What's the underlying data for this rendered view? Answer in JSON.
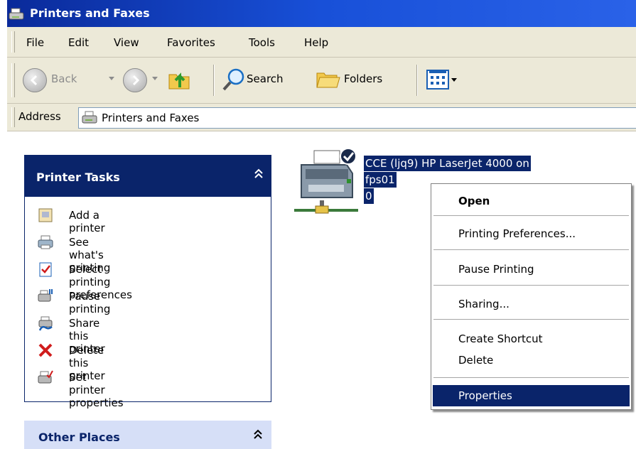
{
  "window": {
    "title": "Printers and Faxes"
  },
  "menu": [
    "File",
    "Edit",
    "View",
    "Favorites",
    "Tools",
    "Help"
  ],
  "toolbar": {
    "back_label": "Back",
    "search_label": "Search",
    "folders_label": "Folders"
  },
  "address": {
    "label": "Address",
    "value": "Printers and Faxes"
  },
  "tasks": {
    "title": "Printer Tasks",
    "items": [
      "Add a printer",
      "See what's printing",
      "Select printing preferences",
      "Pause printing",
      "Share this printer",
      "Delete this printer",
      "Set printer properties"
    ]
  },
  "other_places": {
    "title": "Other Places"
  },
  "printer": {
    "line1": "CCE (ljq9) HP LaserJet 4000 on",
    "line2": "fps01",
    "line3": "0"
  },
  "context_menu": {
    "items": [
      "Open",
      "Printing Preferences...",
      "Pause Printing",
      "Sharing...",
      "Create Shortcut",
      "Delete",
      "Properties"
    ],
    "selected": "Properties"
  },
  "colors": {
    "selection": "#0a246a",
    "titlebar": "#0a2a9a",
    "chrome": "#ece9d8"
  }
}
